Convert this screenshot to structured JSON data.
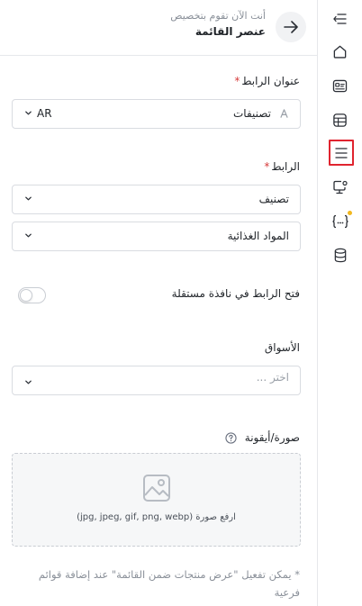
{
  "header": {
    "subtitle": "أنت الآن تقوم بتخصيص",
    "title": "عنصر القائمة",
    "back_icon": "arrow-right-icon"
  },
  "form": {
    "link_title": {
      "label": "عنوان الرابط",
      "required_mark": "*",
      "value": "تصنيفات",
      "language": "AR"
    },
    "link": {
      "label": "الرابط",
      "required_mark": "*",
      "type_value": "تصنيف",
      "target_value": "المواد الغذائية"
    },
    "new_window": {
      "label": "فتح الرابط في نافذة مستقلة",
      "enabled": false
    },
    "markets": {
      "label": "الأسواق",
      "placeholder": "اختر ..."
    },
    "image": {
      "label": "صورة/أيقونة",
      "upload_hint": "ارفع صورة (jpg, jpeg, gif, png, webp)"
    },
    "note": "* يمكن تفعيل \"عرض منتجات ضمن القائمة\" عند إضافة قوائم فرعية"
  },
  "rail": {
    "items": [
      {
        "icon": "collapse-menu-icon"
      },
      {
        "icon": "home-icon"
      },
      {
        "icon": "id-card-icon"
      },
      {
        "icon": "layout-icon"
      },
      {
        "icon": "menu-lines-icon",
        "active": true
      },
      {
        "icon": "monitor-settings-icon"
      },
      {
        "icon": "code-braces-icon",
        "badge": true
      },
      {
        "icon": "database-icon"
      }
    ]
  },
  "colors": {
    "active_highlight": "#e0242f",
    "required": "#d63b3b",
    "badge": "#f2b81f"
  }
}
